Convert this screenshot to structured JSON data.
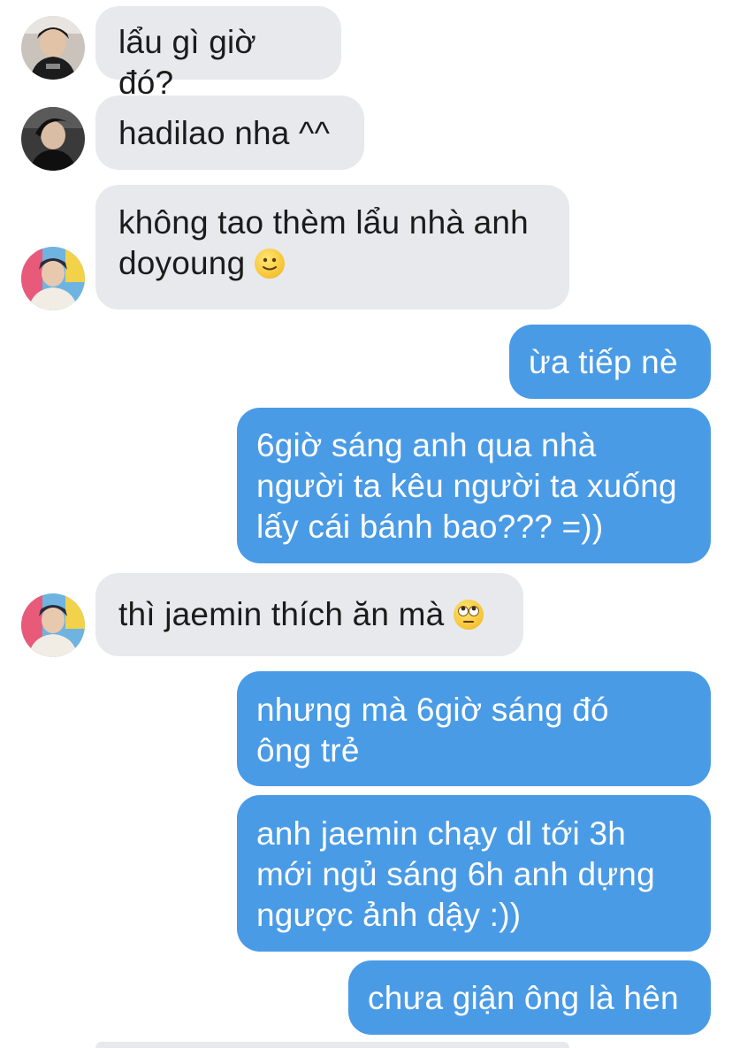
{
  "messages": [
    {
      "id": "m1",
      "side": "incoming",
      "avatar": "dark-avatar",
      "text": "lẩu gì giờ đó?"
    },
    {
      "id": "m2",
      "side": "incoming",
      "avatar": "dark-avatar-2",
      "text": "hadilao nha ^^"
    },
    {
      "id": "m3",
      "side": "incoming",
      "avatar": "colorful-avatar",
      "line1": "không tao thèm lẩu nhà anh",
      "line2": "doyoung",
      "emoji": "slightly-smiling-face-icon"
    },
    {
      "id": "m4",
      "side": "outgoing",
      "text": "ừa tiếp nè"
    },
    {
      "id": "m5",
      "side": "outgoing",
      "line1": "6giờ sáng anh qua nhà",
      "line2": "người ta kêu người ta xuống",
      "line3": "lấy cái bánh bao??? =))"
    },
    {
      "id": "m6",
      "side": "incoming",
      "avatar": "colorful-avatar",
      "text": "thì jaemin thích ăn mà",
      "emoji": "rolling-eyes-face-icon"
    },
    {
      "id": "m7",
      "side": "outgoing",
      "line1": "nhưng mà 6giờ sáng đó",
      "line2": "ông trẻ"
    },
    {
      "id": "m8",
      "side": "outgoing",
      "line1": "anh jaemin chạy dl tới 3h",
      "line2": "mới ngủ sáng 6h anh dựng",
      "line3": "ngược ảnh dậy :))"
    },
    {
      "id": "m9",
      "side": "outgoing",
      "text": "chưa giận ông là hên"
    }
  ],
  "colors": {
    "incoming_bubble": "#e7e9ed",
    "outgoing_bubble": "#4a9be6",
    "incoming_text": "#1b1b1b",
    "outgoing_text": "#ffffff"
  }
}
